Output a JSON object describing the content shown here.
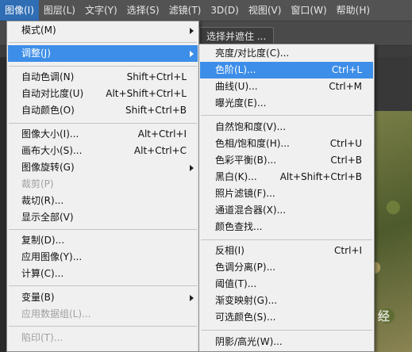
{
  "menubar": {
    "items": [
      {
        "label": "图像(I)"
      },
      {
        "label": "图层(L)"
      },
      {
        "label": "文字(Y)"
      },
      {
        "label": "选择(S)"
      },
      {
        "label": "滤镜(T)"
      },
      {
        "label": "3D(D)"
      },
      {
        "label": "视图(V)"
      },
      {
        "label": "窗口(W)"
      },
      {
        "label": "帮助(H)"
      }
    ]
  },
  "options_bar": {
    "select_mask_label": "选择并遮住 ..."
  },
  "image_menu": {
    "items": [
      {
        "label": "模式(M)",
        "shortcut": ""
      },
      {
        "label": "调整(J)",
        "shortcut": ""
      },
      {
        "label": "自动色调(N)",
        "shortcut": "Shift+Ctrl+L"
      },
      {
        "label": "自动对比度(U)",
        "shortcut": "Alt+Shift+Ctrl+L"
      },
      {
        "label": "自动颜色(O)",
        "shortcut": "Shift+Ctrl+B"
      },
      {
        "label": "图像大小(I)...",
        "shortcut": "Alt+Ctrl+I"
      },
      {
        "label": "画布大小(S)...",
        "shortcut": "Alt+Ctrl+C"
      },
      {
        "label": "图像旋转(G)",
        "shortcut": ""
      },
      {
        "label": "裁剪(P)",
        "shortcut": ""
      },
      {
        "label": "裁切(R)...",
        "shortcut": ""
      },
      {
        "label": "显示全部(V)",
        "shortcut": ""
      },
      {
        "label": "复制(D)...",
        "shortcut": ""
      },
      {
        "label": "应用图像(Y)...",
        "shortcut": ""
      },
      {
        "label": "计算(C)...",
        "shortcut": ""
      },
      {
        "label": "变量(B)",
        "shortcut": ""
      },
      {
        "label": "应用数据组(L)...",
        "shortcut": ""
      },
      {
        "label": "陷印(T)...",
        "shortcut": ""
      }
    ]
  },
  "adjust_menu": {
    "items": [
      {
        "label": "亮度/对比度(C)...",
        "shortcut": ""
      },
      {
        "label": "色阶(L)...",
        "shortcut": "Ctrl+L"
      },
      {
        "label": "曲线(U)...",
        "shortcut": "Ctrl+M"
      },
      {
        "label": "曝光度(E)...",
        "shortcut": ""
      },
      {
        "label": "自然饱和度(V)...",
        "shortcut": ""
      },
      {
        "label": "色相/饱和度(H)...",
        "shortcut": "Ctrl+U"
      },
      {
        "label": "色彩平衡(B)...",
        "shortcut": "Ctrl+B"
      },
      {
        "label": "黑白(K)...",
        "shortcut": "Alt+Shift+Ctrl+B"
      },
      {
        "label": "照片滤镜(F)...",
        "shortcut": ""
      },
      {
        "label": "通道混合器(X)...",
        "shortcut": ""
      },
      {
        "label": "颜色查找...",
        "shortcut": ""
      },
      {
        "label": "反相(I)",
        "shortcut": "Ctrl+I"
      },
      {
        "label": "色调分离(P)...",
        "shortcut": ""
      },
      {
        "label": "阈值(T)...",
        "shortcut": ""
      },
      {
        "label": "渐变映射(G)...",
        "shortcut": ""
      },
      {
        "label": "可选颜色(S)...",
        "shortcut": ""
      },
      {
        "label": "阴影/高光(W)...",
        "shortcut": ""
      }
    ]
  },
  "watermark": "Bai 经验"
}
